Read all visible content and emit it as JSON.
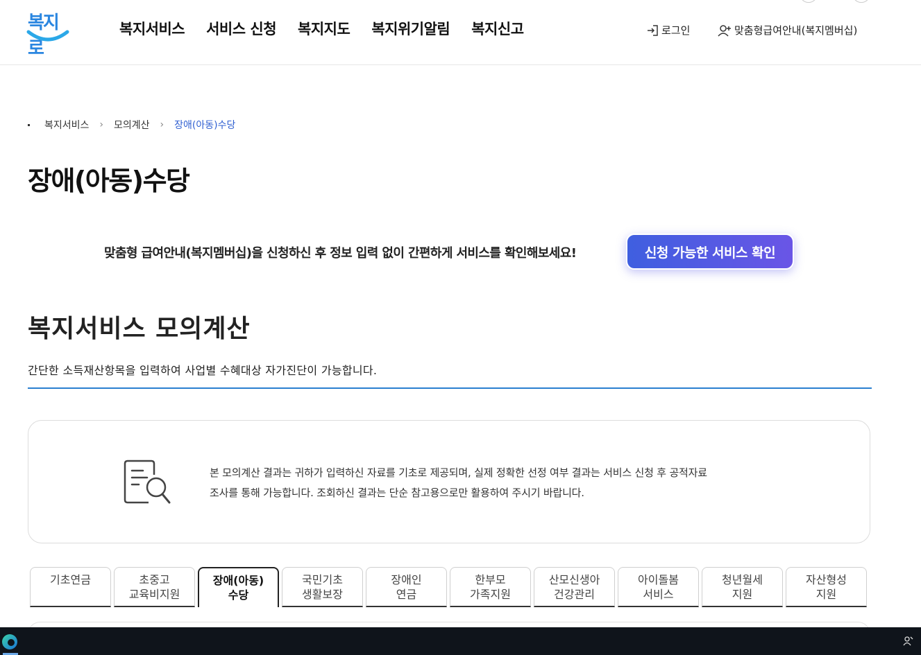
{
  "header": {
    "logo_text": "복지로",
    "nav": [
      "복지서비스",
      "서비스 신청",
      "복지지도",
      "복지위기알림",
      "복지신고"
    ],
    "login_label": "로그인",
    "membership_label": "맞춤형급여안내(복지멤버십)"
  },
  "breadcrumb": [
    "복지서비스",
    "모의계산",
    "장애(아동)수당"
  ],
  "page_title": "장애(아동)수당",
  "promo": {
    "text": "맞춤형 급여안내(복지멤버십)을 신청하신 후 정보 입력 없이 간편하게 서비스를 확인해보세요!",
    "button_label": "신청 가능한 서비스 확인"
  },
  "section": {
    "title": "복지서비스 모의계산",
    "description": "간단한 소득재산항목을 입력하여 사업별 수혜대상 자가진단이 가능합니다."
  },
  "notice": {
    "line1": "본 모의계산 결과는 귀하가 입력하신 자료를 기초로 제공되며, 실제 정확한 선정 여부 결과는 서비스 신청 후 공적자료",
    "line2": "조사를 통해 가능합니다. 조회하신 결과는 단순 참고용으로만 활용하여 주시기 바랍니다."
  },
  "tabs": [
    {
      "line1": "기초연금",
      "line2": ""
    },
    {
      "line1": "초중고",
      "line2": "교육비지원"
    },
    {
      "line1": "장애(아동)",
      "line2": "수당"
    },
    {
      "line1": "국민기초",
      "line2": "생활보장"
    },
    {
      "line1": "장애인",
      "line2": "연금"
    },
    {
      "line1": "한부모",
      "line2": "가족지원"
    },
    {
      "line1": "산모신생아",
      "line2": "건강관리"
    },
    {
      "line1": "아이돌봄",
      "line2": "서비스"
    },
    {
      "line1": "청년월세",
      "line2": "지원"
    },
    {
      "line1": "자산형성",
      "line2": "지원"
    }
  ],
  "active_tab": "장애(아동) 수당",
  "colors": {
    "accent_blue": "#2a7fd0",
    "breadcrumb_current": "#2f5fd1",
    "button_gradient_start": "#3f5fe0",
    "button_gradient_end": "#6a55e6"
  },
  "icons": {
    "login": "login-arrow-icon",
    "membership": "user-plus-icon",
    "notice": "document-search-icon"
  }
}
